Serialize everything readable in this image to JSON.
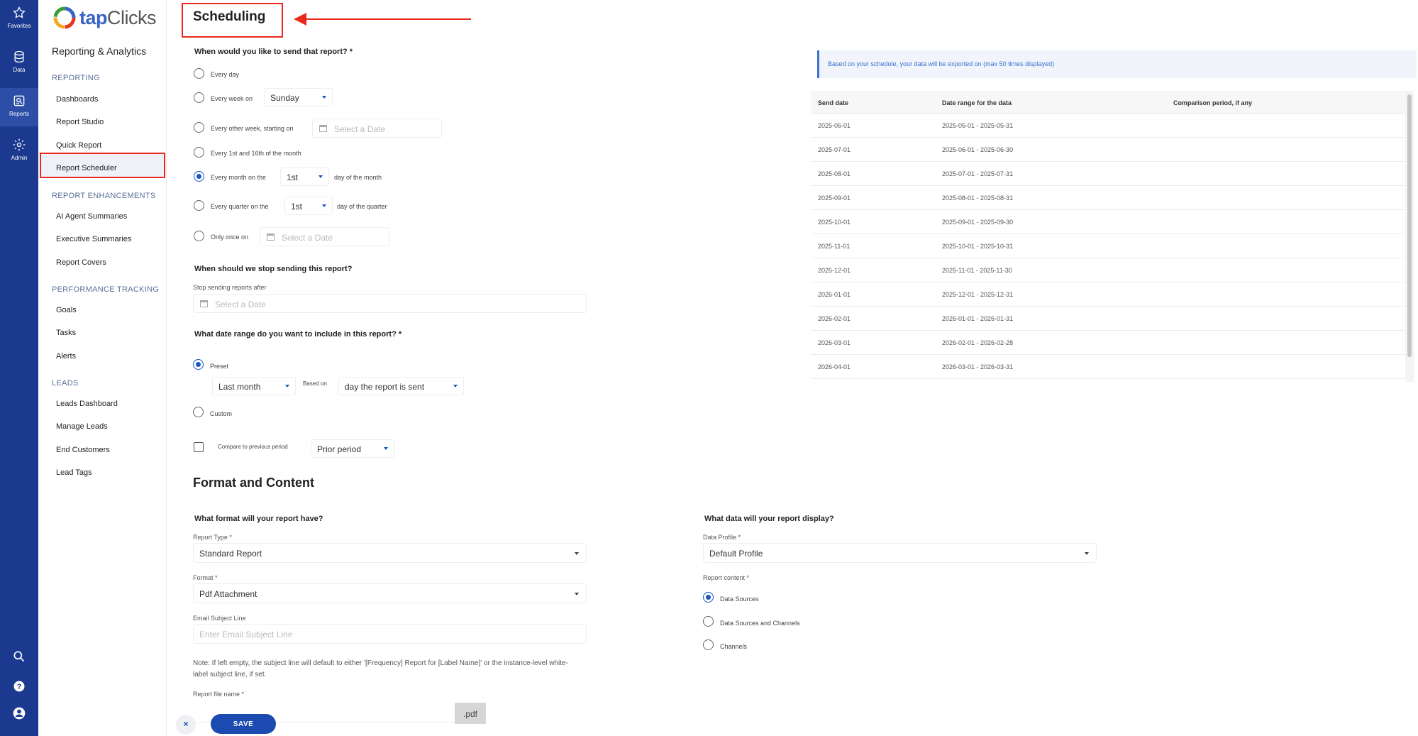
{
  "rail": {
    "items": [
      {
        "label": "Favorites",
        "icon": "star-icon"
      },
      {
        "label": "Data",
        "icon": "database-icon"
      },
      {
        "label": "Reports",
        "icon": "reports-icon"
      },
      {
        "label": "Admin",
        "icon": "gear-icon"
      }
    ],
    "bottom_icons": [
      "search-icon",
      "help-icon",
      "user-icon"
    ]
  },
  "sidebar": {
    "logo_tap": "tap",
    "logo_clicks": "Clicks",
    "app_title": "Reporting & Analytics",
    "sections": [
      {
        "title": "REPORTING",
        "items": [
          "Dashboards",
          "Report Studio",
          "Quick Report",
          "Report Scheduler"
        ]
      },
      {
        "title": "REPORT ENHANCEMENTS",
        "items": [
          "AI Agent Summaries",
          "Executive Summaries",
          "Report Covers"
        ]
      },
      {
        "title": "PERFORMANCE TRACKING",
        "items": [
          "Goals",
          "Tasks",
          "Alerts"
        ]
      },
      {
        "title": "LEADS",
        "items": [
          "Leads Dashboard",
          "Manage Leads",
          "End Customers",
          "Lead Tags"
        ]
      }
    ],
    "active_item": "Report Scheduler"
  },
  "scheduling": {
    "title": "Scheduling",
    "question": "When would you like to send that report? *",
    "options": {
      "every_day": "Every day",
      "every_week": "Every week on",
      "every_week_value": "Sunday",
      "every_other_week": "Every other week, starting on",
      "every_1st_16th": "Every 1st and 16th of the month",
      "every_month": "Every month on the",
      "every_month_value": "1st",
      "every_month_suffix": "day of the month",
      "every_quarter": "Every quarter on the",
      "every_quarter_value": "1st",
      "every_quarter_suffix": "day of the quarter",
      "only_once": "Only once on"
    },
    "date_placeholder": "Select a Date",
    "selected_option": "every_month",
    "stop_question": "When should we stop sending this report?",
    "stop_label": "Stop sending reports after",
    "range_question": "What date range do you want to include in this report? *",
    "preset_label": "Preset",
    "preset_value": "Last month",
    "based_on_label": "Based on",
    "based_on_value": "day the report is sent",
    "custom_label": "Custom",
    "compare_label": "Compare to previous period",
    "compare_value": "Prior period"
  },
  "export_preview": {
    "info": "Based on your schedule, your data will be exported on (max 50 times displayed)",
    "headers": [
      "Send date",
      "Date range for the data",
      "Comparison period, if any"
    ],
    "rows": [
      [
        "2025-06-01",
        "2025-05-01 - 2025-05-31",
        ""
      ],
      [
        "2025-07-01",
        "2025-06-01 - 2025-06-30",
        ""
      ],
      [
        "2025-08-01",
        "2025-07-01 - 2025-07-31",
        ""
      ],
      [
        "2025-09-01",
        "2025-08-01 - 2025-08-31",
        ""
      ],
      [
        "2025-10-01",
        "2025-09-01 - 2025-09-30",
        ""
      ],
      [
        "2025-11-01",
        "2025-10-01 - 2025-10-31",
        ""
      ],
      [
        "2025-12-01",
        "2025-11-01 - 2025-11-30",
        ""
      ],
      [
        "2026-01-01",
        "2025-12-01 - 2025-12-31",
        ""
      ],
      [
        "2026-02-01",
        "2026-01-01 - 2026-01-31",
        ""
      ],
      [
        "2026-03-01",
        "2026-02-01 - 2026-02-28",
        ""
      ],
      [
        "2026-04-01",
        "2026-03-01 - 2026-03-31",
        ""
      ]
    ]
  },
  "format": {
    "title": "Format and Content",
    "format_question": "What format will your report have?",
    "report_type_label": "Report Type *",
    "report_type_value": "Standard Report",
    "format_label": "Format *",
    "format_value": "Pdf Attachment",
    "subject_label": "Email Subject Line",
    "subject_placeholder": "Enter Email Subject Line",
    "note": "Note: If left empty, the subject line will default to either '[Frequency] Report for [Label Name]' or the instance-level white-label subject line, if set.",
    "file_name_label": "Report file name *",
    "file_ext": ".pdf",
    "data_question": "What data will your report display?",
    "data_profile_label": "Data Profile *",
    "data_profile_value": "Default Profile",
    "content_label": "Report content *",
    "content_options": [
      "Data Sources",
      "Data Sources and Channels",
      "Channels"
    ],
    "content_selected": "Data Sources"
  },
  "footer": {
    "save_label": "SAVE",
    "close_label": "×"
  },
  "colors": {
    "rail_bg": "#1b3a8f",
    "accent": "#1b57c4",
    "annotation": "#e8291c"
  }
}
